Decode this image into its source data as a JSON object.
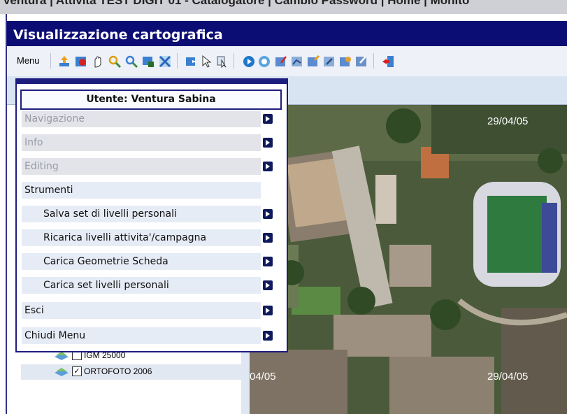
{
  "browser_strip": "Ventura | Attivita TEST DIGIT 01 - Catalogatore | Cambio Password | Home | Monito",
  "window_title": "Visualizzazione cartografica",
  "toolbar": {
    "menu_label": "Menu",
    "icons": [
      "upload-icon",
      "refresh-layers-icon",
      "pan-hand-icon",
      "zoom-in-icon",
      "zoom-out-icon",
      "zoom-window-icon",
      "full-extent-icon",
      "info-icon",
      "select-arrow-icon",
      "select-region-icon",
      "play-icon",
      "stop-icon",
      "edit-point-icon",
      "edit-line-icon",
      "edit-polygon-icon",
      "edit-vertex-icon",
      "delete-icon",
      "save-edit-icon",
      "exit-icon"
    ]
  },
  "popup": {
    "user_label": "Utente: Ventura Sabina",
    "items": [
      {
        "label": "Navigazione",
        "state": "disabled",
        "arrow": true
      },
      {
        "label": "Info",
        "state": "disabled",
        "arrow": true
      },
      {
        "label": "Editing",
        "state": "disabled",
        "arrow": true
      },
      {
        "label": "Strumenti",
        "state": "normal",
        "arrow": false
      },
      {
        "label": "Salva set di livelli personali",
        "state": "sub",
        "arrow": true
      },
      {
        "label": "Ricarica livelli attivita'/campagna",
        "state": "sub",
        "arrow": true
      },
      {
        "label": "Carica Geometrie Scheda",
        "state": "sub",
        "arrow": true
      },
      {
        "label": "Carica set livelli personali",
        "state": "sub",
        "arrow": true
      },
      {
        "label": "Esci",
        "state": "normal",
        "arrow": true
      },
      {
        "label": "Chiudi Menu",
        "state": "normal",
        "arrow": true
      }
    ]
  },
  "layers": [
    {
      "name": "IGM 25000",
      "checked": false
    },
    {
      "name": "ORTOFOTO 2006",
      "checked": true
    }
  ],
  "map": {
    "date_top": "29/04/05",
    "date_bottom_left": "04/05",
    "date_bottom_right": "29/04/05"
  },
  "colors": {
    "title_bg": "#0c0c75",
    "accent": "#1d1d7e",
    "arrow": "#0f1a5c"
  }
}
